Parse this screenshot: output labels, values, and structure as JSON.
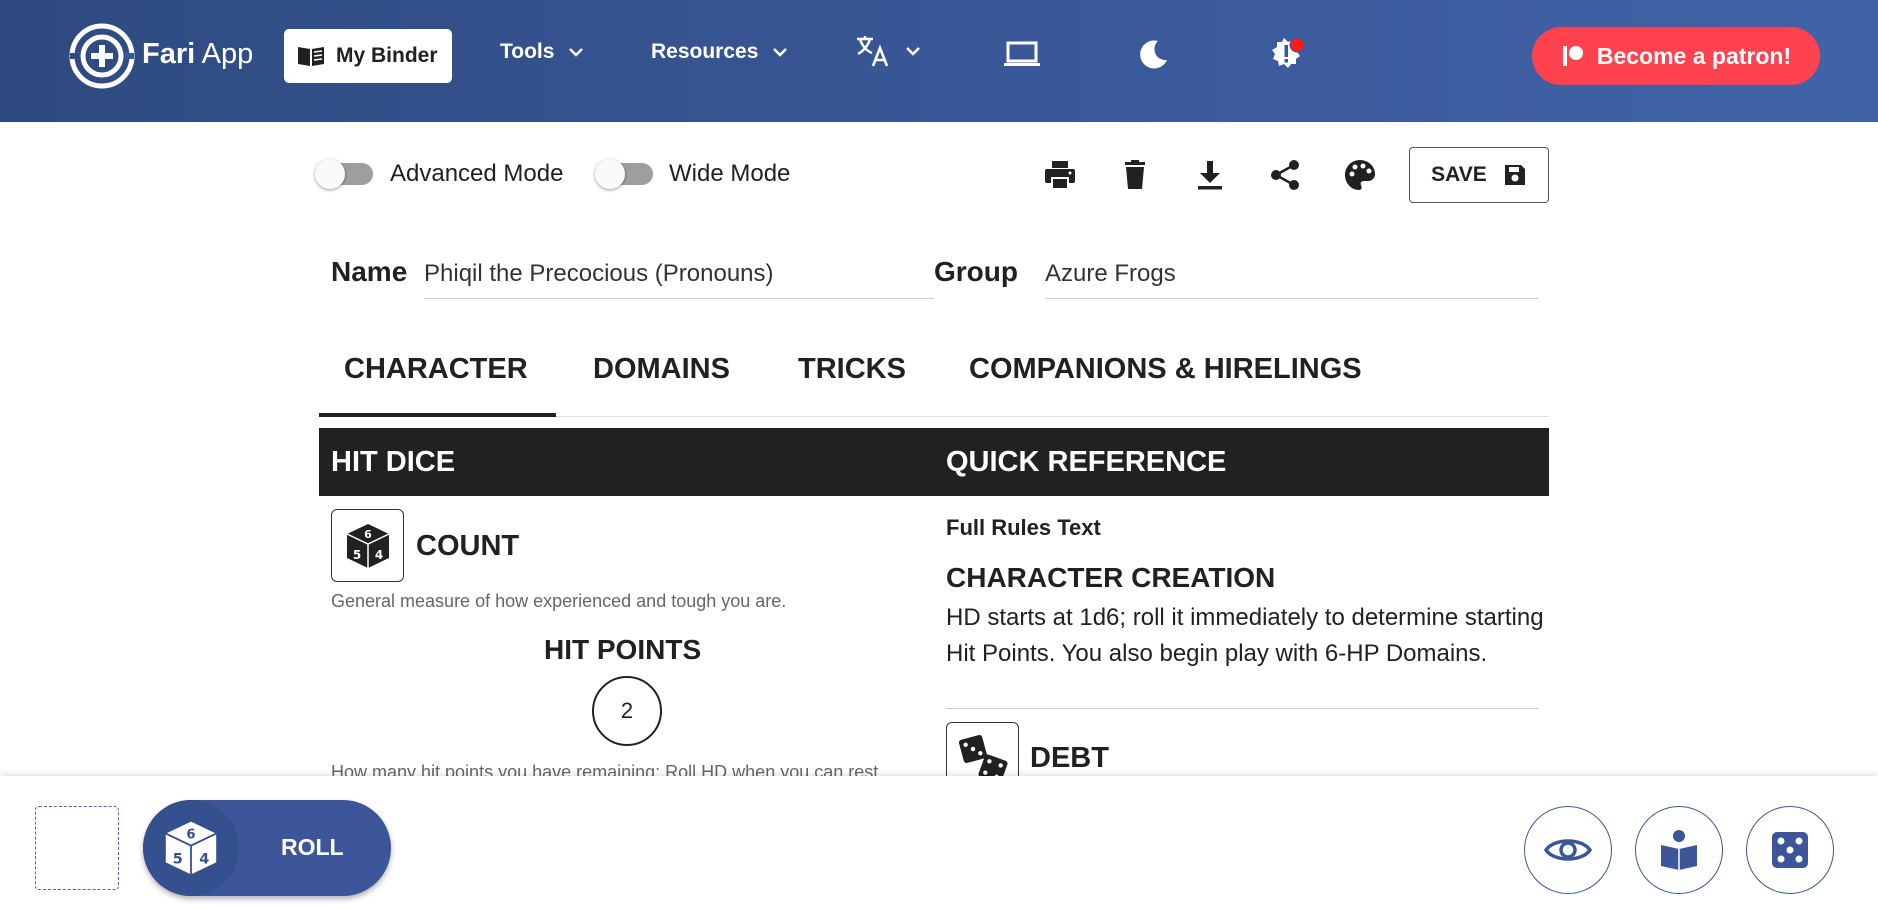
{
  "nav": {
    "logo_bold": "Fari",
    "logo_light": "App",
    "binder": "My Binder",
    "tools": "Tools",
    "resources": "Resources",
    "patron": "Become a patron!"
  },
  "toolbar": {
    "advanced_mode": "Advanced Mode",
    "wide_mode": "Wide Mode",
    "save": "SAVE"
  },
  "sheet": {
    "name_label": "Name",
    "name_value": "Phiqil the Precocious (Pronouns)",
    "group_label": "Group",
    "group_value": "Azure Frogs"
  },
  "tabs": [
    "CHARACTER",
    "DOMAINS",
    "TRICKS",
    "COMPANIONS & HIRELINGS"
  ],
  "hit_dice": {
    "section": "HIT DICE",
    "count_title": "COUNT",
    "count_help": "General measure of how experienced and tough you are.",
    "hp_title": "HIT POINTS",
    "hp_value": "2",
    "hp_help": "How many hit points you have remaining; Roll HD when you can rest"
  },
  "quick_reference": {
    "section": "QUICK REFERENCE",
    "subheading": "Full Rules Text",
    "heading": "CHARACTER CREATION",
    "body": "HD starts at 1d6; roll it immediately to determine starting Hit Points. You also begin play with 6-HP Domains.",
    "debt_title": "DEBT"
  },
  "dock": {
    "roll": "ROLL"
  },
  "colors": {
    "nav_blue": "#3a5898",
    "patron_red": "#ff424d",
    "section_dark": "#212121",
    "dock_blue": "#3c5699"
  }
}
